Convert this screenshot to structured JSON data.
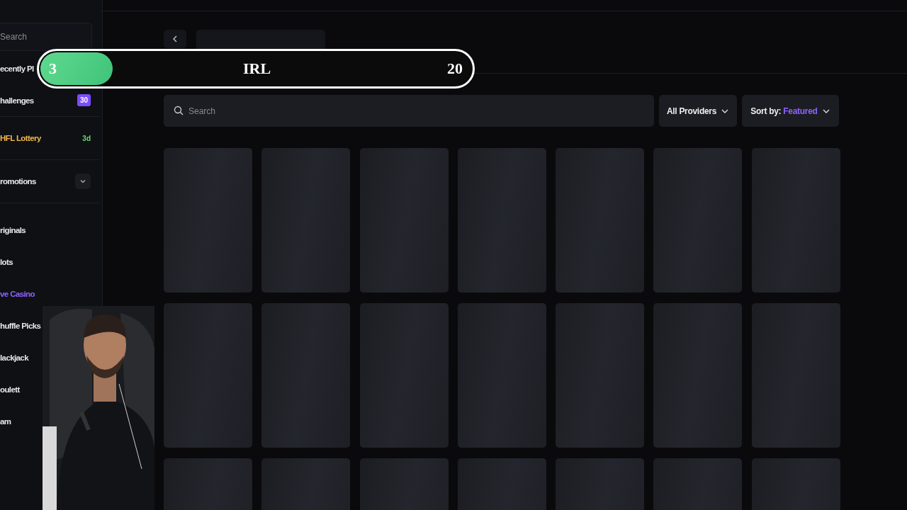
{
  "sidebar": {
    "search": {
      "placeholder": "Search"
    },
    "top_items": [
      {
        "kind": "plain",
        "label": "ecently Pl"
      },
      {
        "kind": "badge",
        "label": "hallenges",
        "badge": "30"
      },
      {
        "kind": "lottery",
        "label": "HFL Lottery",
        "tag": "3d"
      },
      {
        "kind": "dropdown",
        "label": "romotions",
        "expanded": false
      }
    ],
    "nav_items": [
      {
        "label": "riginals",
        "selected": false
      },
      {
        "label": "lots",
        "selected": false
      },
      {
        "label": "ve Casino",
        "selected": true
      },
      {
        "label": "huffle Picks",
        "selected": false
      },
      {
        "label": "lackjack",
        "selected": false
      },
      {
        "label": "oulett",
        "selected": false
      },
      {
        "label": "am",
        "selected": false
      }
    ]
  },
  "stream_overlay": {
    "count": "3",
    "title": "IRL",
    "goal": "20",
    "level": 0.15
  },
  "filters": {
    "search": {
      "placeholder": "Search"
    },
    "providers": "All Providers",
    "sort_label": "Sort by:",
    "sort_value": "Featured"
  }
}
